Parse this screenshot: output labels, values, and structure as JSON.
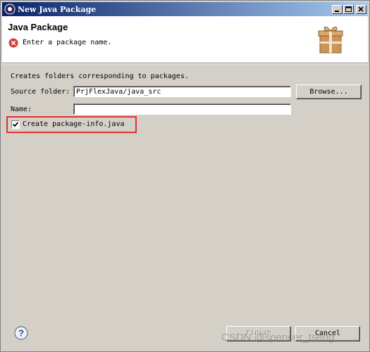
{
  "window": {
    "title": "New Java Package",
    "app_icon": "eclipse-icon",
    "controls": [
      "minimize-icon",
      "maximize-icon",
      "close-icon"
    ]
  },
  "banner": {
    "heading": "Java Package",
    "message": "Enter a package name.",
    "message_icon": "error-icon",
    "wizard_icon": "package-gift-icon"
  },
  "form": {
    "description": "Creates folders corresponding to packages.",
    "source_folder": {
      "label": "Source folder:",
      "value": "PrjFlexJava/java_src"
    },
    "browse_label": "Browse...",
    "name": {
      "label": "Name:",
      "value": ""
    },
    "create_package_info": {
      "label": "Create package-info.java",
      "checked": true
    }
  },
  "footer": {
    "help_icon": "help-icon",
    "finish_label": "Finish",
    "finish_enabled": false,
    "cancel_label": "Cancel"
  },
  "watermark": "CSDN @spencer_tseng",
  "colors": {
    "titlebar_start": "#0a246a",
    "titlebar_end": "#a6caf0",
    "dialog_bg": "#d4d0c8",
    "highlight_border": "#e03030",
    "error_red": "#d93a3a"
  }
}
